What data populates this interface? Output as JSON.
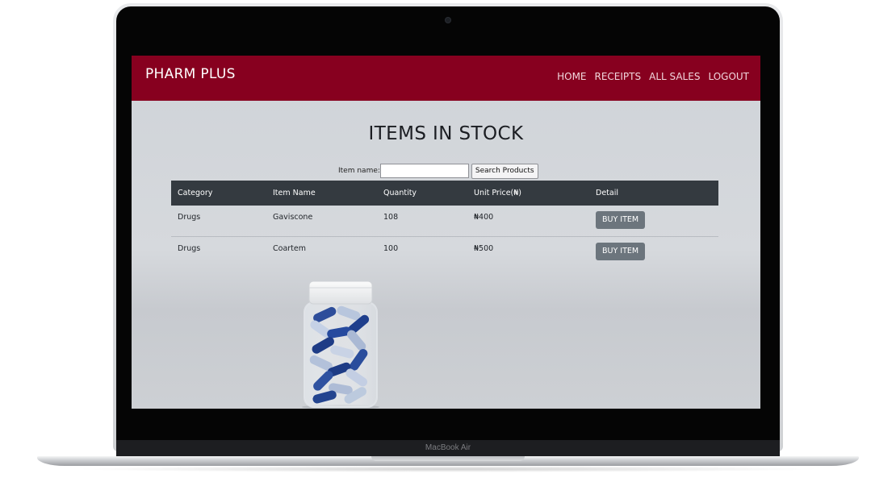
{
  "device": {
    "label": "MacBook Air"
  },
  "navbar": {
    "brand": "PHARM PLUS",
    "links": [
      "HOME",
      "RECEIPTS",
      "ALL SALES",
      "LOGOUT"
    ],
    "color": "#87001f"
  },
  "page": {
    "title": "ITEMS IN STOCK"
  },
  "search": {
    "label": "Item name:",
    "value": "",
    "button_label": "Search Products"
  },
  "table": {
    "headers": [
      "Category",
      "Item Name",
      "Quantity",
      "Unit Price(₦)",
      "Detail"
    ],
    "rows": [
      {
        "category": "Drugs",
        "item_name": "Gaviscone",
        "quantity": "108",
        "unit_price": "₦400",
        "action": "BUY ITEM"
      },
      {
        "category": "Drugs",
        "item_name": "Coartem",
        "quantity": "100",
        "unit_price": "₦500",
        "action": "BUY ITEM"
      }
    ],
    "header_color": "#343a40",
    "button_color": "#6c757d"
  },
  "background_image": {
    "icon": "pill-jar-icon"
  }
}
